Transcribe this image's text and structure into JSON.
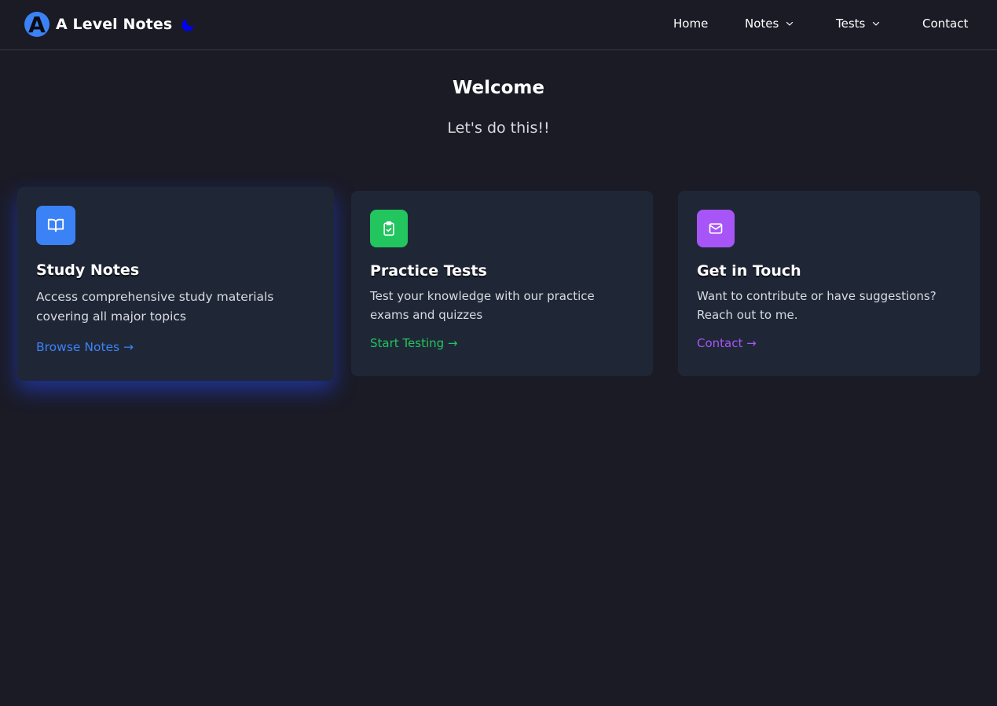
{
  "brand": {
    "title": "A Level Notes",
    "logo_letter": "A",
    "logo_color": "#3b82f6",
    "theme_icon": "moon-icon",
    "theme_icon_color": "#0000ff"
  },
  "nav": {
    "home": "Home",
    "notes": "Notes",
    "tests": "Tests",
    "contact": "Contact"
  },
  "hero": {
    "title": "Welcome",
    "tagline": "Let's do this!!"
  },
  "cards": [
    {
      "title": "Study Notes",
      "description": "Access comprehensive study materials covering all major topics",
      "link": "Browse Notes →",
      "icon": "book-icon",
      "accent": "#3b82f6"
    },
    {
      "title": "Practice Tests",
      "description": "Test your knowledge with our practice exams and quizzes",
      "link": "Start Testing →",
      "icon": "clipboard-check-icon",
      "accent": "#22c55e"
    },
    {
      "title": "Get in Touch",
      "description": "Want to contribute or have suggestions? Reach out to me.",
      "link": "Contact →",
      "icon": "mail-icon",
      "accent": "#a855f7"
    }
  ],
  "colors": {
    "background": "#1b1b26",
    "card_background": "#1f2736",
    "header_border": "#3a3b47"
  }
}
